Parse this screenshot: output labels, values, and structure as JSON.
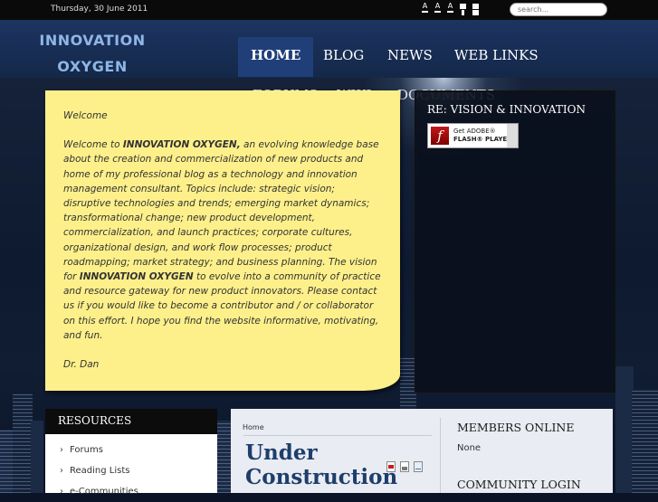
{
  "topbar": {
    "date": "Thursday, 30 June 2011",
    "font_controls": [
      "A",
      "A",
      "A"
    ],
    "search_placeholder": "search..."
  },
  "header": {
    "logo_line1": "INNOVATION",
    "logo_line2": "OXYGEN"
  },
  "nav": {
    "items": [
      "HOME",
      "BLOG",
      "NEWS",
      "WEB LINKS",
      "FORUMS",
      "WIKI",
      "DOCUMENTS"
    ],
    "active": "HOME"
  },
  "welcome": {
    "heading": "Welcome",
    "p1_intro": "Welcome to ",
    "brand": "INNOVATION OXYGEN,",
    "p1_body": " an evolving knowledge base about the creation and commercialization of new products and home of my professional blog as a technology and innovation management consultant. Topics include: strategic vision; disruptive technologies and trends; emerging market dynamics; transformational change; new product development, commercialization, and launch practices; corporate cultures, organizational design, and work flow processes; product roadmapping; market strategy; and business planning. The vision for ",
    "brand2": "INNOVATION OXYGEN",
    "p1_end": " to evolve into a community of practice and resource gateway for new product innovators. Please contact us if you would like to become a contributor and / or collaborator on this effort. I hope you find the website informative, motivating, and fun.",
    "signature": "Dr. Dan"
  },
  "flash_panel": {
    "title": "RE: VISION & INNOVATION",
    "badge_line1": "Get ADOBE®",
    "badge_line2": "FLASH® PLAYER"
  },
  "resources": {
    "title": "RESOURCES",
    "items": [
      "Forums",
      "Reading Lists",
      "e-Communities"
    ]
  },
  "main": {
    "breadcrumb": "Home",
    "title_line1": "Under",
    "title_line2": "Construction"
  },
  "members": {
    "title": "MEMBERS ONLINE",
    "value": "None"
  },
  "login": {
    "title": "COMMUNITY LOGIN"
  },
  "colors": {
    "accent_nav": "#203f79",
    "header_bg": "#1d3461",
    "note_bg": "#fdf08a",
    "logo_text": "#8eb6e6",
    "title_text": "#1e3e6b"
  }
}
